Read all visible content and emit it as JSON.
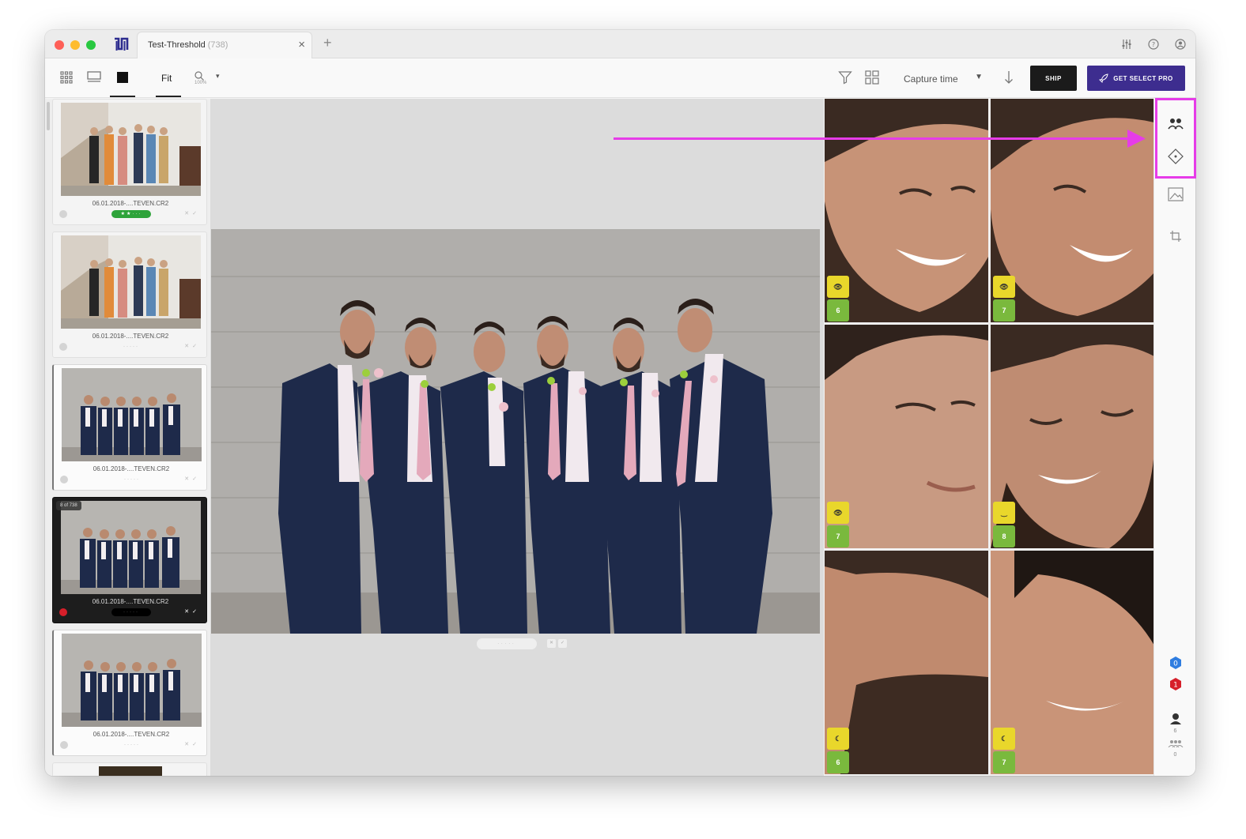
{
  "tab": {
    "title": "Test-Threshold",
    "count": "(738)"
  },
  "toolbar": {
    "fit_label": "Fit",
    "zoom_percent": "100%",
    "sort_label": "Capture time",
    "ship_label": "SHIP",
    "pro_label": "GET SELECT PRO"
  },
  "filmstrip": {
    "items": [
      {
        "name": "06.01.2018-....TEVEN.CR2",
        "rating": "★★···"
      },
      {
        "name": "06.01.2018-....TEVEN.CR2",
        "rating": "·····"
      },
      {
        "name": "06.01.2018-....TEVEN.CR2",
        "rating": "·····"
      },
      {
        "name": "06.01.2018-....TEVEN.CR2",
        "rating": "·····",
        "counter": "8 of 738"
      },
      {
        "name": "06.01.2018-....TEVEN.CR2",
        "rating": "·····"
      }
    ]
  },
  "viewer": {
    "rating": "·····"
  },
  "faces": [
    {
      "status": "eye-open-icon",
      "score": "6"
    },
    {
      "status": "eye-open-icon",
      "score": "7"
    },
    {
      "status": "eye-open-icon",
      "score": "7"
    },
    {
      "status": "eye-closed-icon",
      "score": "8"
    },
    {
      "status": "profile-face-icon",
      "score": "6"
    },
    {
      "status": "profile-face-icon",
      "score": "7"
    }
  ],
  "rail": {
    "info_count": "0",
    "warning_count": "1",
    "person_count": "6",
    "group_count": "0"
  },
  "colors": {
    "highlight": "#e63ce8",
    "pro_button": "#3d2d8f",
    "rating_green": "#2ea33a",
    "badge_yellow": "#e9d72b",
    "badge_green": "#7ab93d"
  }
}
